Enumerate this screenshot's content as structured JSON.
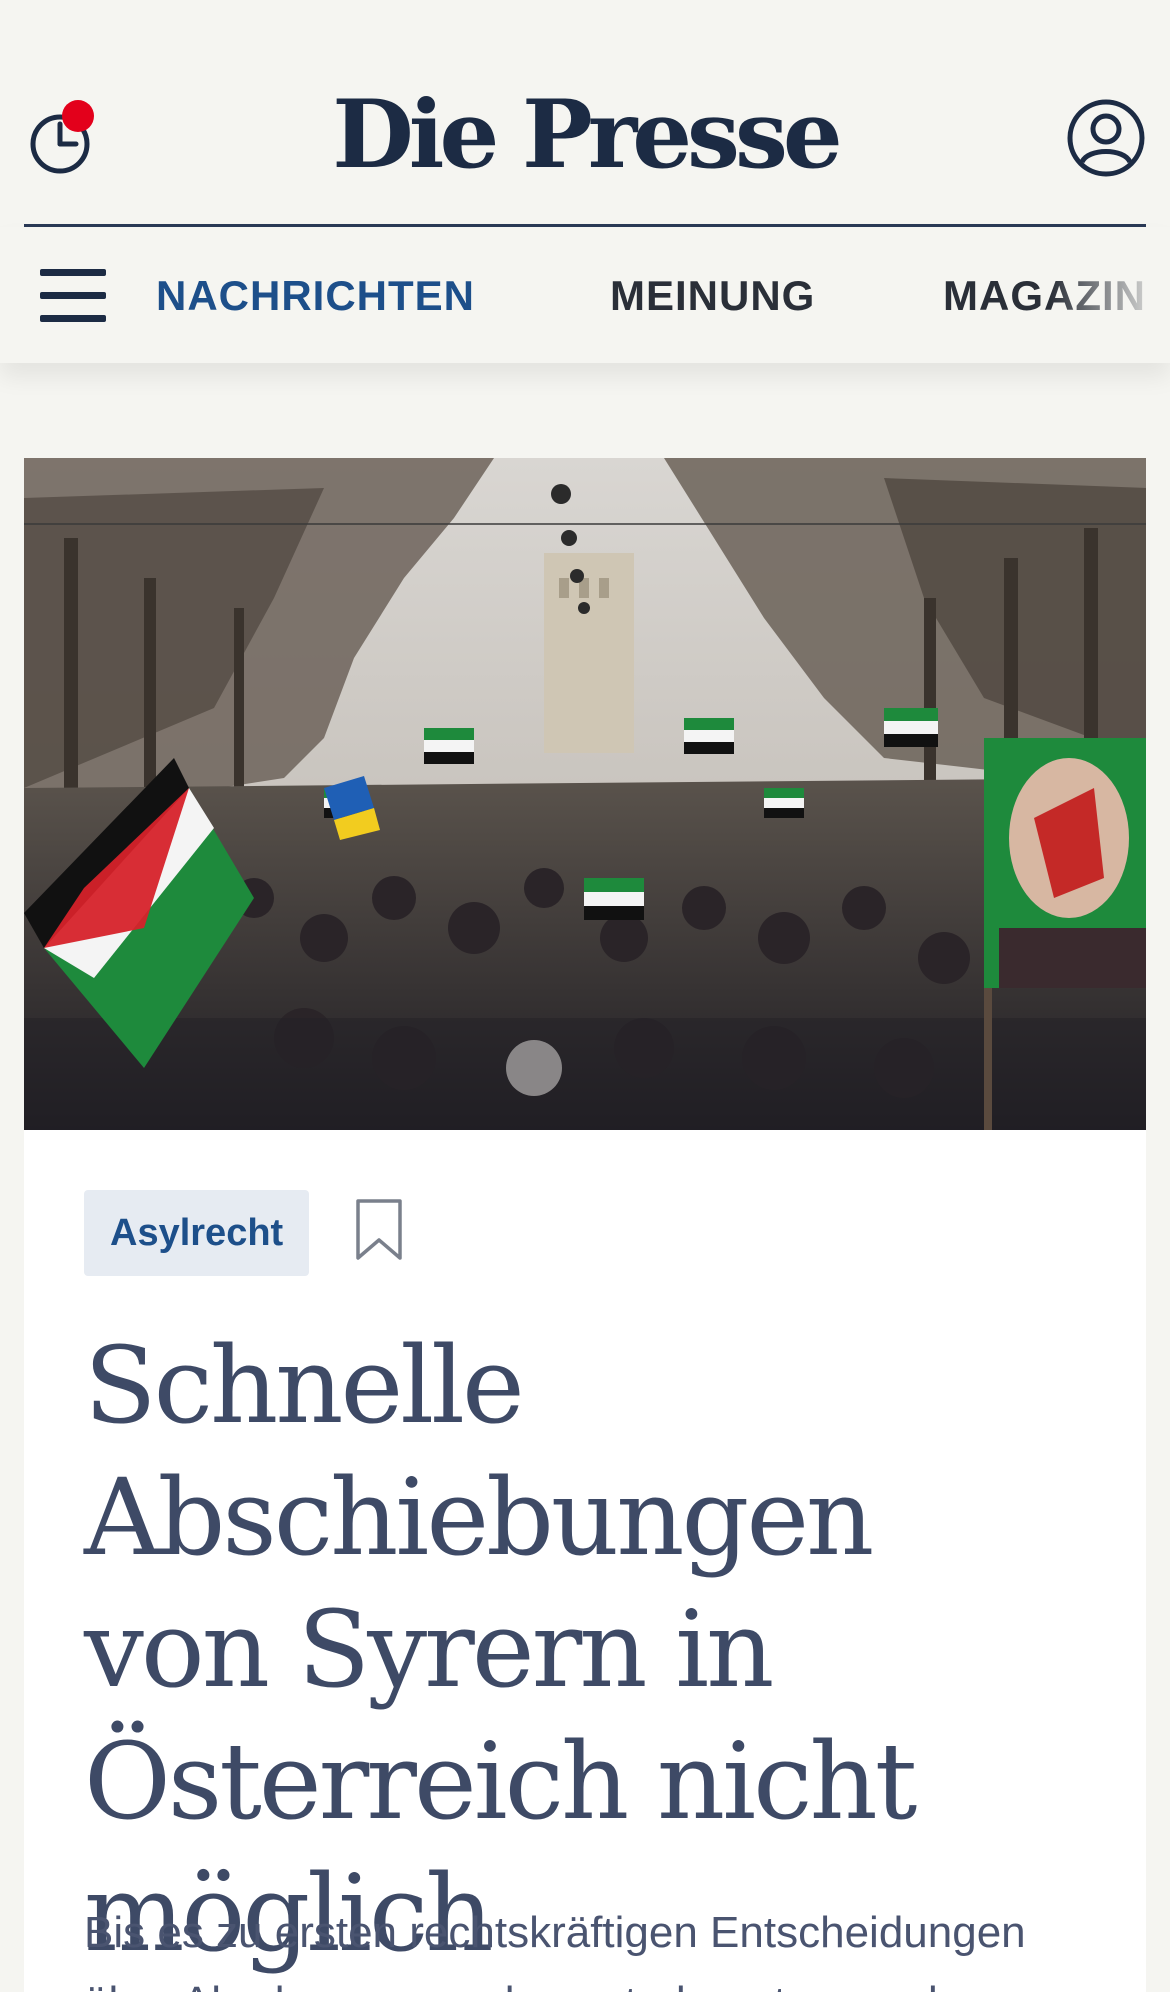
{
  "header": {
    "logo": "Die Presse",
    "history_icon": "clock-history-icon",
    "notification_dot_color": "#e3001b",
    "account_icon": "user-account-icon"
  },
  "nav": {
    "menu_icon": "hamburger-menu-icon",
    "items": [
      {
        "label": "NACHRICHTEN",
        "active": true
      },
      {
        "label": "MEINUNG",
        "active": false
      },
      {
        "label": "MAGAZIN",
        "active": false
      }
    ]
  },
  "article": {
    "image": "Protest crowd waving Syrian opposition and Palestinian flags on a tree-lined street",
    "tag": "Asylrecht",
    "bookmark_icon": "bookmark-icon",
    "headline": "Schnelle Abschiebungen von Syrern in Österreich nicht möglich",
    "lead": "Bis es zu ersten rechtskräftigen Entscheidungen über Aberkennungen kommt, dauert es noch"
  },
  "colors": {
    "brand_navy": "#1c2b44",
    "nav_active": "#1d4f8a",
    "headline": "#3e4a66",
    "tag_bg": "#e6ebf2"
  }
}
